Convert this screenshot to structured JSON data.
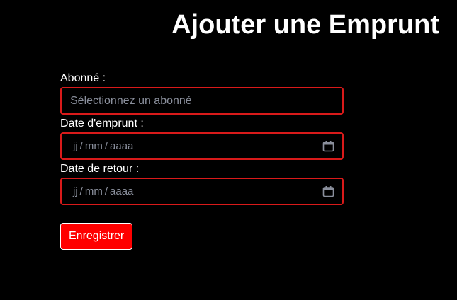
{
  "page": {
    "title": "Ajouter une Emprunt"
  },
  "form": {
    "subscriber": {
      "label": "Abonné :",
      "placeholder": "Sélectionnez un abonné"
    },
    "borrow_date": {
      "label": "Date d'emprunt :",
      "day": "jj",
      "month": "mm",
      "year": "aaaa",
      "separator": "/",
      "icon": "calendar-icon"
    },
    "return_date": {
      "label": "Date de retour :",
      "day": "jj",
      "month": "mm",
      "year": "aaaa",
      "separator": "/",
      "icon": "calendar-icon"
    },
    "submit_label": "Enregistrer"
  },
  "colors": {
    "background": "#000000",
    "accent": "#ff0000",
    "field_border": "#d91a1a",
    "placeholder": "#8a8f9c"
  }
}
